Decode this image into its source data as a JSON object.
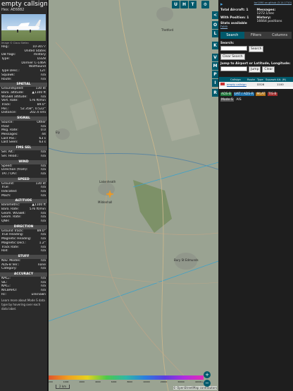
{
  "header": {
    "title": "empty callsign",
    "hex_label": "Hex:",
    "hex": "AE6882",
    "image_credit": "Image © Claus Stefan"
  },
  "aircraft": [
    {
      "label": "Reg.:",
      "value": "10-3077"
    },
    {
      "label": "",
      "value": "United States"
    },
    {
      "label": "DB flags:",
      "value": "military"
    },
    {
      "label": "Type:",
      "value": "D328"
    },
    {
      "label": "",
      "value": "Dornier C-146A"
    },
    {
      "label": "",
      "value": "Wolfhound"
    },
    {
      "label": "Type Desc.:",
      "value": "L2T"
    },
    {
      "label": "Squawk:",
      "value": "n/a"
    },
    {
      "label": "Route:",
      "value": "n/a"
    }
  ],
  "sections": [
    {
      "title": "SPATIAL",
      "rows": [
        [
          "Groundspeed:",
          "130 kt"
        ],
        [
          "Baro. altitude:",
          "▲1100 ft"
        ],
        [
          "WGS84 altitude:",
          "n/a"
        ],
        [
          "Vert. Rate:",
          "576 ft/min"
        ],
        [
          "Track:",
          "89.0°"
        ],
        [
          "Pos.:",
          "52.358°, 0.522°"
        ],
        [
          "Distance:",
          "202.4 nmi"
        ]
      ]
    },
    {
      "title": "SIGNAL",
      "rows": [
        [
          "Source:",
          "Other"
        ],
        [
          "RSSI:",
          "n/a"
        ],
        [
          "Msg. Rate:",
          "0.0"
        ],
        [
          "Messages:",
          "44"
        ],
        [
          "Last Pos.:",
          "63 s"
        ],
        [
          "Last Seen:",
          "63 s"
        ]
      ]
    },
    {
      "title": "FMS SEL",
      "rows": [
        [
          "Sel. Alt.:",
          "n/a"
        ],
        [
          "Sel. Head.:",
          "n/a"
        ]
      ]
    },
    {
      "title": "WIND",
      "rows": [
        [
          "Speed:",
          "n/a"
        ],
        [
          "Direction (from):",
          "n/a"
        ],
        [
          "TAT / OAT:",
          "n/a"
        ]
      ]
    },
    {
      "title": "SPEED",
      "rows": [
        [
          "Ground:",
          "130 kt"
        ],
        [
          "True:",
          "n/a"
        ],
        [
          "Indicated:",
          "n/a"
        ],
        [
          "Mach:",
          "n/a"
        ]
      ]
    },
    {
      "title": "ALTITUDE",
      "rows": [
        [
          "Barometric:",
          "▲1100 ft"
        ],
        [
          "Baro. Rate:",
          "576 ft/min"
        ],
        [
          "Geom. WGS84:",
          "n/a"
        ],
        [
          "Geom. Rate:",
          "n/a"
        ],
        [
          "QNH:",
          "n/a"
        ]
      ]
    },
    {
      "title": "DIRECTION",
      "rows": [
        [
          "Ground Track:",
          "89.0°"
        ],
        [
          "True Heading:",
          "n/a"
        ],
        [
          "Magnetic Heading:",
          "n/a"
        ],
        [
          "Magnetic Decl.:",
          "1.2°"
        ],
        [
          "Track Rate:",
          "n/a"
        ],
        [
          "Roll:",
          "n/a"
        ]
      ]
    },
    {
      "title": "STUFF",
      "rows": [
        [
          "Nav. Modes:",
          "n/a"
        ],
        [
          "ADS-B Ver.:",
          "none"
        ],
        [
          "Category:",
          "n/a"
        ]
      ]
    },
    {
      "title": "ACCURACY",
      "rows": [
        [
          "NACₚ:",
          "n/a"
        ],
        [
          "SIL:",
          "n/a"
        ],
        [
          "NACᵥ:",
          "n/a"
        ],
        [
          "NICBARO:",
          "n/a"
        ],
        [
          "Rc:",
          "unknown"
        ]
      ]
    }
  ],
  "footer": "Learn more about Mode S data type by hovering over each data label.",
  "map_buttons_top": [
    "U",
    "H",
    "T"
  ],
  "map_buttons_right": [
    "<",
    "O",
    "L",
    "K",
    "V",
    "M",
    "P",
    "I",
    "R"
  ],
  "map_labels": [
    "Lakenheath",
    "Mildenhall",
    "Bury St Edmunds",
    "Thetford",
    "Ely"
  ],
  "attribution": "© OpenStreetMap contributors",
  "scale": "2 km",
  "altitude_scale": [
    "200",
    "1000",
    "2000",
    "4000",
    "6000",
    "8000",
    "10000",
    "20000",
    "30000",
    "40000+"
  ],
  "panel": {
    "link": "tar1090 on github (3.14.1710)",
    "total_label": "Total Aircraft:",
    "total": "1",
    "messages_label": "Messages:",
    "messages": "1272.1/sec",
    "withpos_label": "With Position:",
    "withpos": "1",
    "history_label": "History:",
    "history": "16664 positions",
    "stats": "Stats available",
    "stats_link": "here",
    "tabs": [
      "Search",
      "Filters",
      "Columns"
    ],
    "search_label": "Search:",
    "search_btn": "Search",
    "clear_btn": "Clear Search",
    "jump_label": "Jump to Airport or Latitude, Longitude:",
    "jump_btn": "Jump",
    "clear2": "Clear",
    "table_headers": [
      "Callsign",
      "Route",
      "Type",
      "Squawk",
      "Alt. (ft)"
    ],
    "table_row": {
      "callsign": "empty callsign",
      "type": "D328",
      "alt": "1100"
    },
    "tags": [
      "ADS-B",
      "UAT / ADS-R",
      "MLAT",
      "TIS-B",
      "Mode-S",
      "AIS"
    ]
  }
}
